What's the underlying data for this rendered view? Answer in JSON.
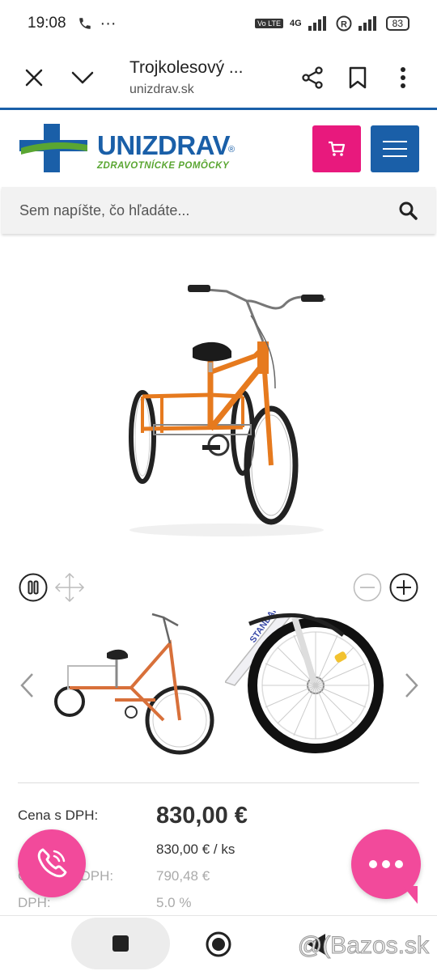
{
  "status_bar": {
    "time": "19:08",
    "battery": "83",
    "net": "4G"
  },
  "browser": {
    "title": "Trojkolesový ...",
    "host": "unizdrav.sk"
  },
  "site": {
    "logo_text": "UNIZDRAV",
    "logo_sub": "ZDRAVOTNÍCKE POMÔCKY",
    "brand_blue": "#1a5fa8",
    "brand_pink": "#e8197d",
    "brand_green": "#5aa632"
  },
  "search": {
    "placeholder": "Sem napíšte, čo hľadáte..."
  },
  "product": {
    "thumb_label": "STANDARD",
    "prices": [
      {
        "label": "Cena s DPH:",
        "value": "830,00 €"
      },
      {
        "label": "",
        "value": "830,00 € / ks"
      },
      {
        "label": "Cena bez DPH:",
        "value": "790,48 €"
      },
      {
        "label": "DPH:",
        "value": "5.0 %"
      }
    ]
  },
  "watermark": "@(Bazos.sk"
}
